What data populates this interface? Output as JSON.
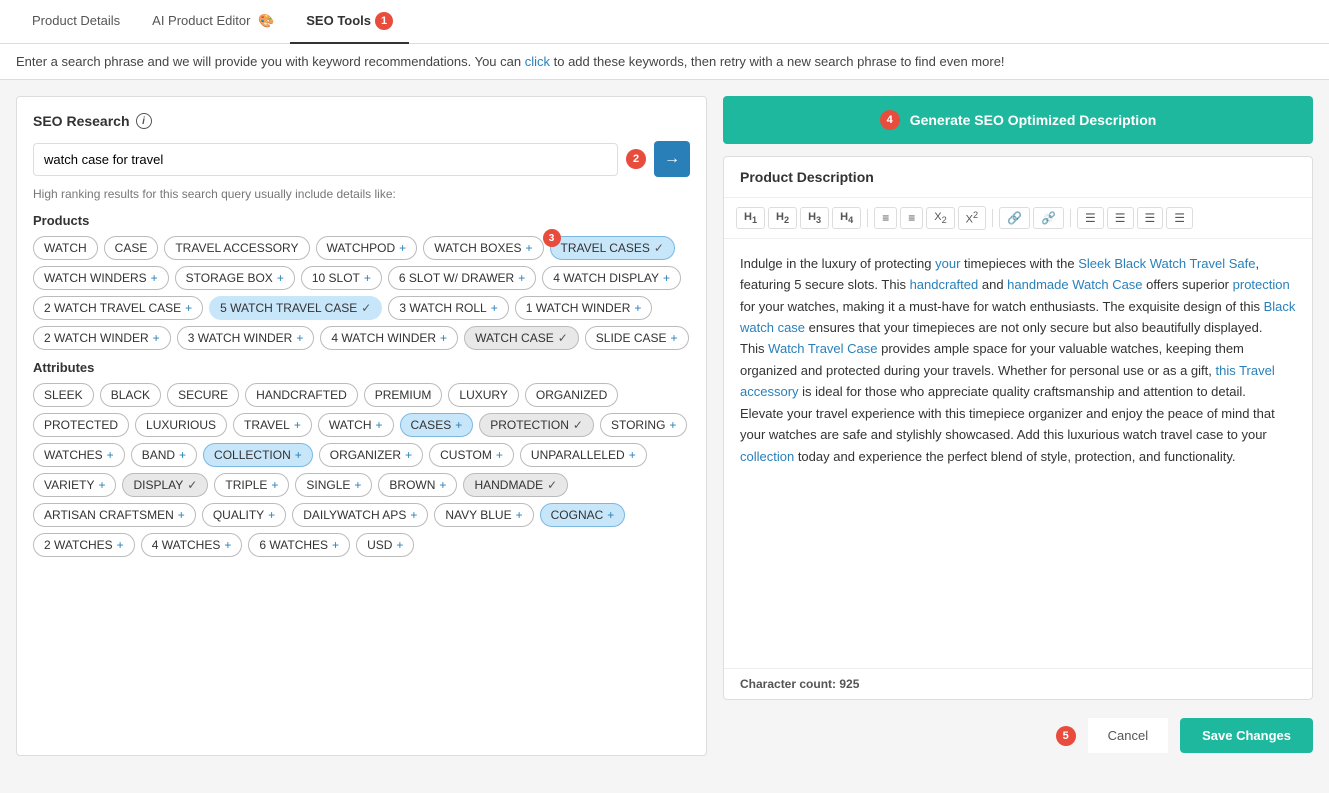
{
  "tabs": [
    {
      "label": "Product Details",
      "active": false
    },
    {
      "label": "AI Product Editor",
      "active": false,
      "icon": "🎨"
    },
    {
      "label": "SEO Tools",
      "active": true,
      "badge": "1"
    }
  ],
  "infoBar": {
    "text": "Enter a search phrase and we will provide you with keyword recommendations. You can click to add these keywords, then retry with a new search phrase to find even more!"
  },
  "leftPanel": {
    "seoResearch": "SEO Research",
    "searchValue": "watch case for travel",
    "searchPlaceholder": "watch case for travel",
    "hintText": "High ranking results for this search query usually include details like:",
    "step2Badge": "2",
    "step3Badge": "3",
    "productsLabel": "Products",
    "attributesLabel": "Attributes",
    "productTags": [
      {
        "label": "WATCH",
        "type": "plain"
      },
      {
        "label": "CASE",
        "type": "plain"
      },
      {
        "label": "TRAVEL ACCESSORY",
        "type": "plain"
      },
      {
        "label": "WATCHPOD",
        "type": "plus"
      },
      {
        "label": "WATCH BOXES",
        "type": "plus"
      },
      {
        "label": "TRAVEL CASES",
        "type": "selected-check"
      },
      {
        "label": "WATCH WINDERS",
        "type": "plus"
      },
      {
        "label": "STORAGE BOX",
        "type": "plus"
      },
      {
        "label": "10 SLOT",
        "type": "plus"
      },
      {
        "label": "6 SLOT W/ DRAWER",
        "type": "plus"
      },
      {
        "label": "4 WATCH DISPLAY",
        "type": "plus"
      },
      {
        "label": "2 WATCH TRAVEL CASE",
        "type": "plus"
      },
      {
        "label": "5 WATCH TRAVEL CASE",
        "type": "selected-check"
      },
      {
        "label": "3 WATCH ROLL",
        "type": "plus"
      },
      {
        "label": "1 WATCH WINDER",
        "type": "plus"
      },
      {
        "label": "2 WATCH WINDER",
        "type": "plus"
      },
      {
        "label": "3 WATCH WINDER",
        "type": "plus"
      },
      {
        "label": "4 WATCH WINDER",
        "type": "plus"
      },
      {
        "label": "WATCH CASE",
        "type": "selected-check"
      },
      {
        "label": "SLIDE CASE",
        "type": "plus"
      }
    ],
    "attributeTags": [
      {
        "label": "SLEEK",
        "type": "plain"
      },
      {
        "label": "BLACK",
        "type": "plain"
      },
      {
        "label": "SECURE",
        "type": "plain"
      },
      {
        "label": "HANDCRAFTED",
        "type": "plain"
      },
      {
        "label": "PREMIUM",
        "type": "plain"
      },
      {
        "label": "LUXURY",
        "type": "plain"
      },
      {
        "label": "ORGANIZED",
        "type": "plain"
      },
      {
        "label": "PROTECTED",
        "type": "plain"
      },
      {
        "label": "LUXURIOUS",
        "type": "plain"
      },
      {
        "label": "TRAVEL",
        "type": "plus"
      },
      {
        "label": "WATCH",
        "type": "plus"
      },
      {
        "label": "CASES",
        "type": "plus"
      },
      {
        "label": "PROTECTION",
        "type": "selected-check"
      },
      {
        "label": "STORING",
        "type": "plus"
      },
      {
        "label": "WATCHES",
        "type": "plus"
      },
      {
        "label": "BAND",
        "type": "plus"
      },
      {
        "label": "COLLECTION",
        "type": "plus"
      },
      {
        "label": "ORGANIZER",
        "type": "plus"
      },
      {
        "label": "CUSTOM",
        "type": "plus"
      },
      {
        "label": "UNPARALLELED",
        "type": "plus"
      },
      {
        "label": "VARIETY",
        "type": "plus"
      },
      {
        "label": "DISPLAY",
        "type": "selected-check"
      },
      {
        "label": "TRIPLE",
        "type": "plus"
      },
      {
        "label": "SINGLE",
        "type": "plus"
      },
      {
        "label": "BROWN",
        "type": "plus"
      },
      {
        "label": "HANDMADE",
        "type": "selected-check"
      },
      {
        "label": "ARTISAN CRAFTSMEN",
        "type": "plus"
      },
      {
        "label": "QUALITY",
        "type": "plus"
      },
      {
        "label": "DAILYWATCH APS",
        "type": "plus"
      },
      {
        "label": "NAVY BLUE",
        "type": "plus"
      },
      {
        "label": "COGNAC",
        "type": "plus"
      },
      {
        "label": "2 WATCHES",
        "type": "plus"
      },
      {
        "label": "4 WATCHES",
        "type": "plus"
      },
      {
        "label": "6 WATCHES",
        "type": "plus"
      },
      {
        "label": "USD",
        "type": "plus"
      }
    ]
  },
  "rightPanel": {
    "generateLabel": "Generate SEO Optimized Description",
    "generateBadge": "4",
    "descriptionTitle": "Product Description",
    "content": {
      "paragraph1": "Indulge in the luxury of protecting your timepieces with the Sleek Black Watch Travel Safe, featuring 5 secure slots. This handcrafted and handmade Watch Case offers superior protection for your watches, making it a must-have for watch enthusiasts. The exquisite design of this Black watch case ensures that your timepieces are not only secure but also beautifully displayed.",
      "paragraph2": "This Watch Travel Case provides ample space for your valuable watches, keeping them organized and protected during your travels. Whether for personal use or as a gift, this Travel accessory is ideal for those who appreciate quality craftsmanship and attention to detail.",
      "paragraph3": "Elevate your travel experience with this timepiece organizer and enjoy the peace of mind that your watches are safe and stylishly showcased. Add this luxurious watch travel case to your collection today and experience the perfect blend of style, protection, and functionality."
    },
    "charCount": "Character count: 925",
    "cancelLabel": "Cancel",
    "saveLabel": "Save Changes",
    "step5Badge": "5"
  },
  "toolbar": {
    "buttons": [
      "H₁",
      "H₂",
      "H₃",
      "H₄",
      "≡",
      "≡",
      "X₂",
      "X²",
      "🔗",
      "🔗✗",
      "≡",
      "≡",
      "≡",
      "≡"
    ]
  }
}
